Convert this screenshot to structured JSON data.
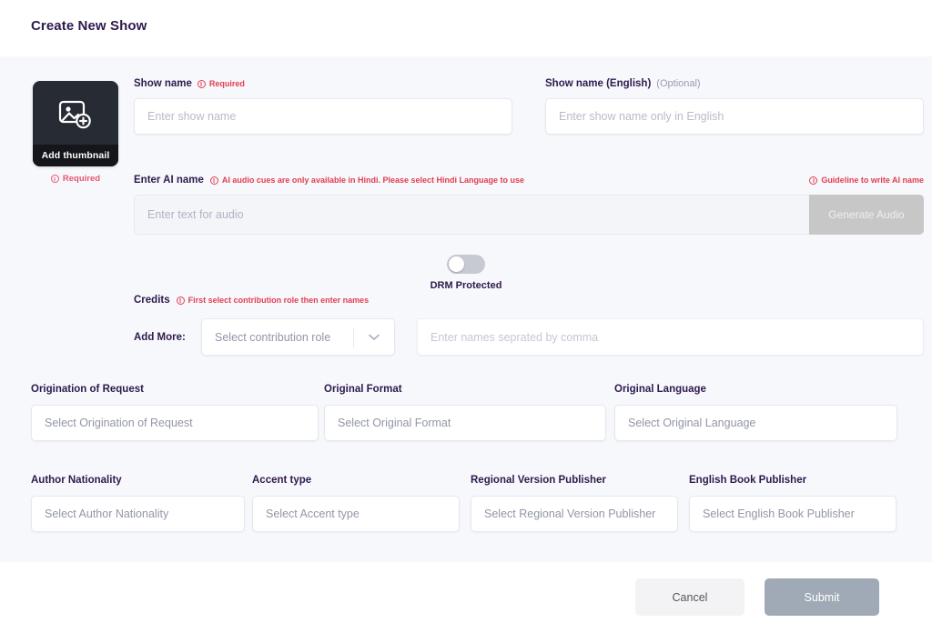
{
  "header": {
    "title": "Create New Show"
  },
  "thumbnail": {
    "icon": "image-add-icon",
    "caption": "Add thumbnail",
    "required_label": "Required",
    "required_icon": "info-circle-icon"
  },
  "show_name": {
    "label": "Show name",
    "required_badge": "Required",
    "required_icon": "info-circle-icon",
    "placeholder": "Enter show name",
    "value": ""
  },
  "show_name_english": {
    "label": "Show name (English)",
    "optional_badge": "(Optional)",
    "placeholder": "Enter show name only in English",
    "value": ""
  },
  "ai_name": {
    "label": "Enter AI name",
    "hint_icon": "info-circle-icon",
    "hint": "AI audio cues are only available in Hindi. Please select Hindi Language to use",
    "guideline_icon": "info-circle-icon",
    "guideline_link": "Guideline to write AI name",
    "placeholder": "Enter text for audio",
    "value": "",
    "generate_button": "Generate Audio"
  },
  "drm": {
    "label": "DRM Protected",
    "state": "off"
  },
  "credits": {
    "label": "Credits",
    "hint_icon": "info-circle-icon",
    "hint": "First select contribution role then enter names",
    "add_more_label": "Add More:",
    "role_placeholder": "Select contribution role",
    "role_value": "",
    "chevron_icon": "chevron-down-icon",
    "names_placeholder": "Enter names seprated by comma",
    "names_value": ""
  },
  "row_a": [
    {
      "label": "Origination of Request",
      "placeholder": "Select Origination of Request",
      "value": ""
    },
    {
      "label": "Original Format",
      "placeholder": "Select Original Format",
      "value": ""
    },
    {
      "label": "Original Language",
      "placeholder": "Select Original Language",
      "value": ""
    }
  ],
  "row_b": [
    {
      "label": "Author Nationality",
      "placeholder": "Select Author Nationality",
      "value": ""
    },
    {
      "label": "Accent type",
      "placeholder": "Select Accent type",
      "value": ""
    },
    {
      "label": "Regional Version Publisher",
      "placeholder": "Select Regional Version Publisher",
      "value": ""
    },
    {
      "label": "English Book Publisher",
      "placeholder": "Select English Book Publisher",
      "value": ""
    }
  ],
  "footer": {
    "cancel_label": "Cancel",
    "submit_label": "Submit"
  },
  "colors": {
    "accent_dark": "#2e1a4d",
    "required_red": "#e23d51",
    "panel_bg": "#f7f8fc",
    "thumb_bg": "#272b33",
    "submit_bg": "#a0aab6",
    "generate_bg": "#c7c7c7"
  }
}
